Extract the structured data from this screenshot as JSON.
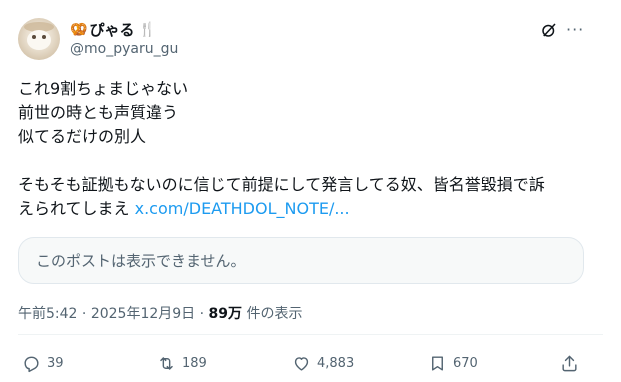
{
  "author": {
    "display_name": "ぴゃる",
    "prefix_emoji": "🥨",
    "suffix_emoji": "🍴",
    "handle": "@mo_pyaru_gu"
  },
  "header_icons": {
    "grok": "slashed-circle-icon",
    "more": "···"
  },
  "post": {
    "lines": [
      "これ9割ちょまじゃない",
      "前世の時とも声質違う",
      "似てるだけの別人",
      "",
      "そもそも証拠もないのに信じて前提にして発言してる奴、皆名誉毀損で訴",
      "えられてしまえ"
    ],
    "link_text": "x.com/DEATHDOL_NOTE/..."
  },
  "quote": {
    "unavailable_text": "このポストは表示できません。"
  },
  "meta": {
    "time": "午前5:42",
    "sep": " · ",
    "date": "2025年12月9日",
    "views_count": "89万",
    "views_label": " 件の表示"
  },
  "actions": {
    "replies": "39",
    "reposts": "189",
    "likes": "4,883",
    "bookmarks": "670"
  },
  "colors": {
    "link": "#1d9bf0",
    "muted": "#536471",
    "text": "#0f1419"
  }
}
